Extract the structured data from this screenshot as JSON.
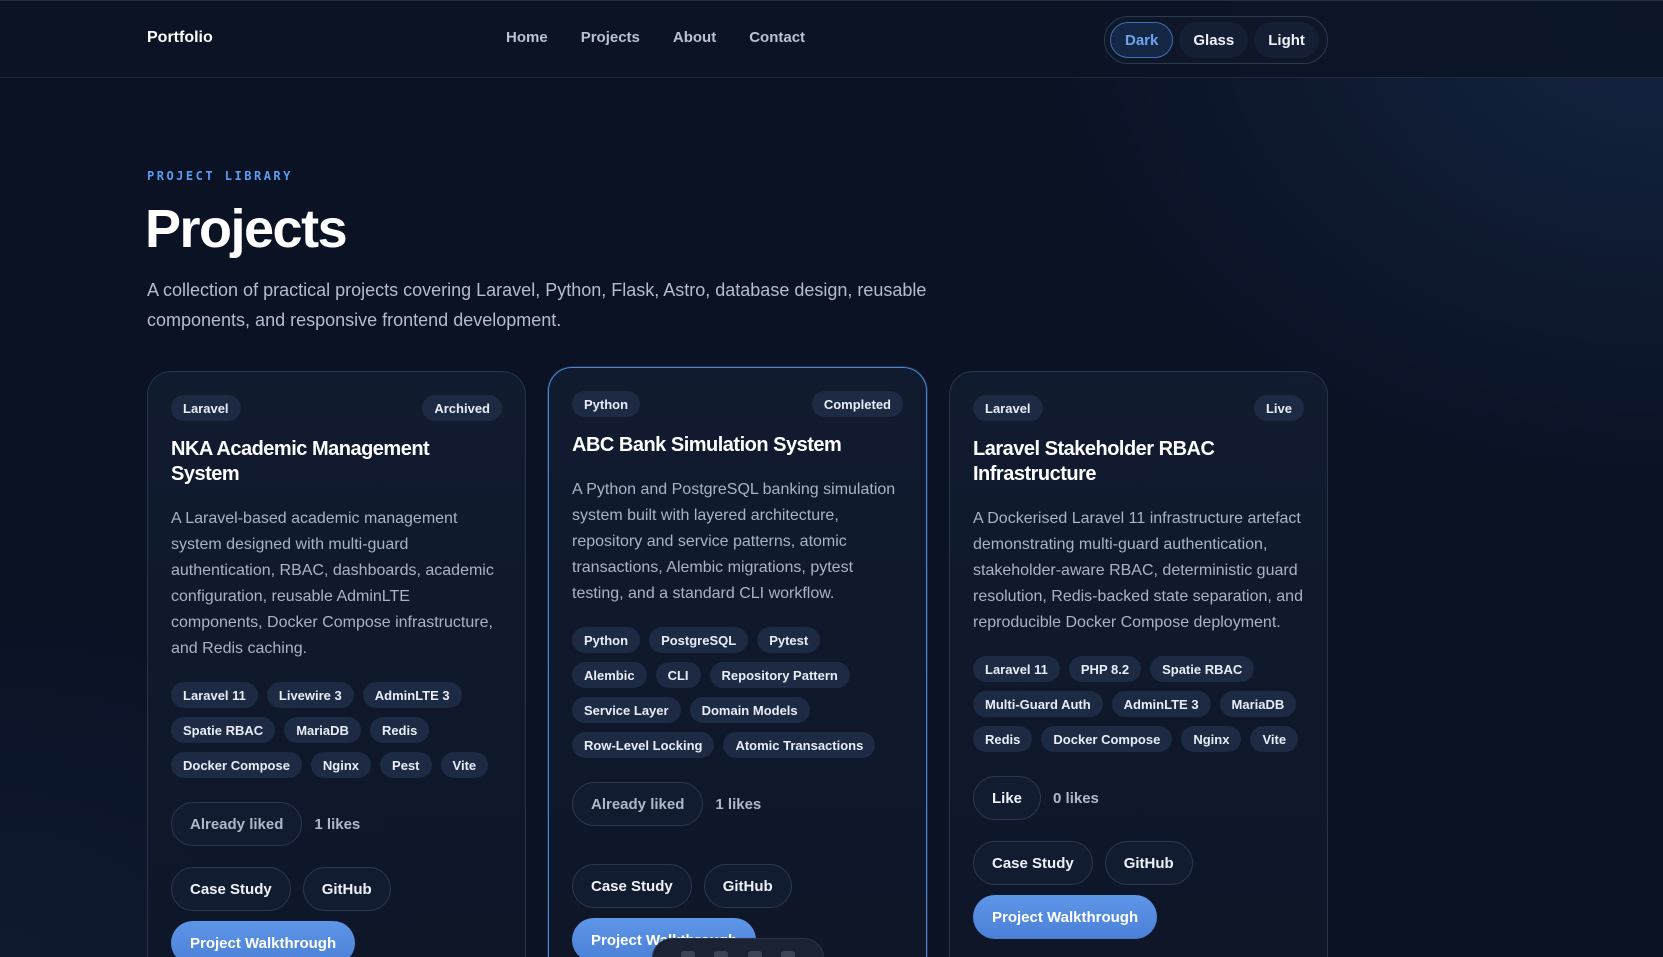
{
  "nav": {
    "brand": "Portfolio",
    "links": [
      "Home",
      "Projects",
      "About",
      "Contact"
    ],
    "themes": [
      "Dark",
      "Glass",
      "Light"
    ],
    "active_theme": "Dark"
  },
  "hero": {
    "eyebrow": "PROJECT LIBRARY",
    "title": "Projects",
    "description": "A collection of practical projects covering Laravel, Python, Flask, Astro, database design, reusable components, and responsive frontend development."
  },
  "cards": [
    {
      "category": "Laravel",
      "status": "Archived",
      "title": "NKA Academic Management System",
      "description": "A Laravel-based academic management system designed with multi-guard authentication, RBAC, dashboards, academic configuration, reusable AdminLTE components, Docker Compose infrastructure, and Redis caching.",
      "tags": [
        "Laravel 11",
        "Livewire 3",
        "AdminLTE 3",
        "Spatie RBAC",
        "MariaDB",
        "Redis",
        "Docker Compose",
        "Nginx",
        "Pest",
        "Vite"
      ],
      "like_label": "Already liked",
      "likes": "1 likes",
      "case_study": "Case Study",
      "github": "GitHub",
      "walkthrough": "Project Walkthrough"
    },
    {
      "category": "Python",
      "status": "Completed",
      "title": "ABC Bank Simulation System",
      "description": "A Python and PostgreSQL banking simulation system built with layered architecture, repository and service patterns, atomic transactions, Alembic migrations, pytest testing, and a standard CLI workflow.",
      "tags": [
        "Python",
        "PostgreSQL",
        "Pytest",
        "Alembic",
        "CLI",
        "Repository Pattern",
        "Service Layer",
        "Domain Models",
        "Row-Level Locking",
        "Atomic Transactions"
      ],
      "like_label": "Already liked",
      "likes": "1 likes",
      "case_study": "Case Study",
      "github": "GitHub",
      "walkthrough": "Project Walkthrough"
    },
    {
      "category": "Laravel",
      "status": "Live",
      "title": "Laravel Stakeholder RBAC Infrastructure",
      "description": "A Dockerised Laravel 11 infrastructure artefact demonstrating multi-guard authentication, stakeholder-aware RBAC, deterministic guard resolution, Redis-backed state separation, and reproducible Docker Compose deployment.",
      "tags": [
        "Laravel 11",
        "PHP 8.2",
        "Spatie RBAC",
        "Multi-Guard Auth",
        "AdminLTE 3",
        "MariaDB",
        "Redis",
        "Docker Compose",
        "Nginx",
        "Vite"
      ],
      "like_label": "Like",
      "likes": "0 likes",
      "case_study": "Case Study",
      "github": "GitHub",
      "walkthrough": "Project Walkthrough"
    }
  ]
}
